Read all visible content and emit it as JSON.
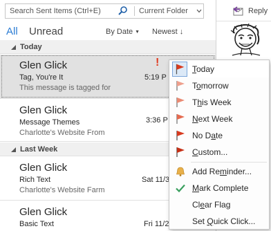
{
  "search": {
    "placeholder": "Search Sent Items (Ctrl+E)",
    "scope": "Current Folder"
  },
  "filters": {
    "all": "All",
    "unread": "Unread",
    "sort_by": "By Date",
    "sort_order": "Newest"
  },
  "groups": [
    {
      "label": "Today"
    },
    {
      "label": "Last Week"
    }
  ],
  "mails": [
    {
      "from": "Glen Glick",
      "subject": "Tag, You're It",
      "preview": "This message is tagged for",
      "time": "5:19 P",
      "importance": "!"
    },
    {
      "from": "Glen Glick",
      "subject": "Message Themes",
      "preview": "Charlotte's Website  From",
      "time": "3:36 P"
    },
    {
      "from": "Glen Glick",
      "subject": "Rich Text",
      "preview": "Charlotte's Website  Farm",
      "time": "Sat 11/3"
    },
    {
      "from": "Glen Glick",
      "subject": "Basic Text",
      "preview": "",
      "time": "Fri 11/2"
    }
  ],
  "reading_pane": {
    "reply_label": "Reply"
  },
  "context_menu": {
    "items": [
      {
        "label": "Today",
        "icon": "flag-red-icon"
      },
      {
        "label": "Tomorrow",
        "icon": "flag-light-icon"
      },
      {
        "label": "This Week",
        "icon": "flag-light-icon"
      },
      {
        "label": "Next Week",
        "icon": "flag-light-icon"
      },
      {
        "label": "No Date",
        "icon": "flag-red-icon"
      },
      {
        "label": "Custom...",
        "icon": "flag-red-icon"
      },
      {
        "label": "Add Reminder...",
        "icon": "bell-icon"
      },
      {
        "label": "Mark Complete",
        "icon": "checkmark-icon"
      },
      {
        "label": "Clear Flag",
        "icon": ""
      },
      {
        "label": "Set Quick Click...",
        "icon": ""
      }
    ]
  },
  "colors": {
    "accent": "#2b7cd3",
    "flag_red": "#d83b1f",
    "flag_light": "#eea08d",
    "importance": "#e03a1f",
    "check": "#3a9f5e",
    "bell": "#e8b04a"
  }
}
